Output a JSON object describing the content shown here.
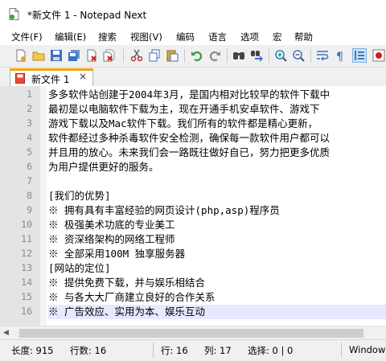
{
  "window": {
    "title": "*新文件 1 - Notepad Next"
  },
  "menu": [
    "文件(F)",
    "编辑(E)",
    "搜索",
    "视图(V)",
    "编码",
    "语言",
    "选项",
    "宏",
    "帮助"
  ],
  "toolbar": {
    "icons": [
      "new-file-icon",
      "open-file-icon",
      "save-icon",
      "save-all-icon",
      "close-icon",
      "close-all-icon",
      "cut-icon",
      "copy-icon",
      "paste-icon",
      "undo-icon",
      "redo-icon",
      "find-icon",
      "replace-icon",
      "zoom-in-icon",
      "zoom-out-icon",
      "word-wrap-icon",
      "show-all-chars-icon",
      "indent-guide-icon",
      "record-macro-icon"
    ]
  },
  "tab": {
    "label": "新文件 1",
    "close": "×"
  },
  "editor": {
    "current_line": 16,
    "lines": [
      "多多软件站创建于2004年3月，是国内相对比较早的软件下载中",
      "最初是以电脑软件下载为主，现在开通手机安卓软件、游戏下",
      "游戏下载以及Mac软件下载。我们所有的软件都是精心更新，",
      "软件都经过多种杀毒软件安全检测，确保每一款软件用户都可以",
      "并且用的放心。未来我们会一路既往做好自已，努力把更多优质",
      "为用户提供更好的服务。",
      "",
      "[我们的优势]",
      "※ 拥有具有丰富经验的网页设计(php,asp)程序员",
      "※ 极强美术功底的专业美工",
      "※ 资深络架构的网络工程师",
      "※ 全部采用100M 独享服务器",
      "[网站的定位]",
      "※ 提供免费下载，并与娱乐相结合",
      "※ 与各大大厂商建立良好的合作关系",
      "※ 广告效应、实用为本、娱乐互动"
    ]
  },
  "status": {
    "length": "长度: 915",
    "lines": "行数: 16",
    "row": "行: 16",
    "col": "列: 17",
    "selection": "选择: 0 | 0",
    "eol": "Window"
  }
}
